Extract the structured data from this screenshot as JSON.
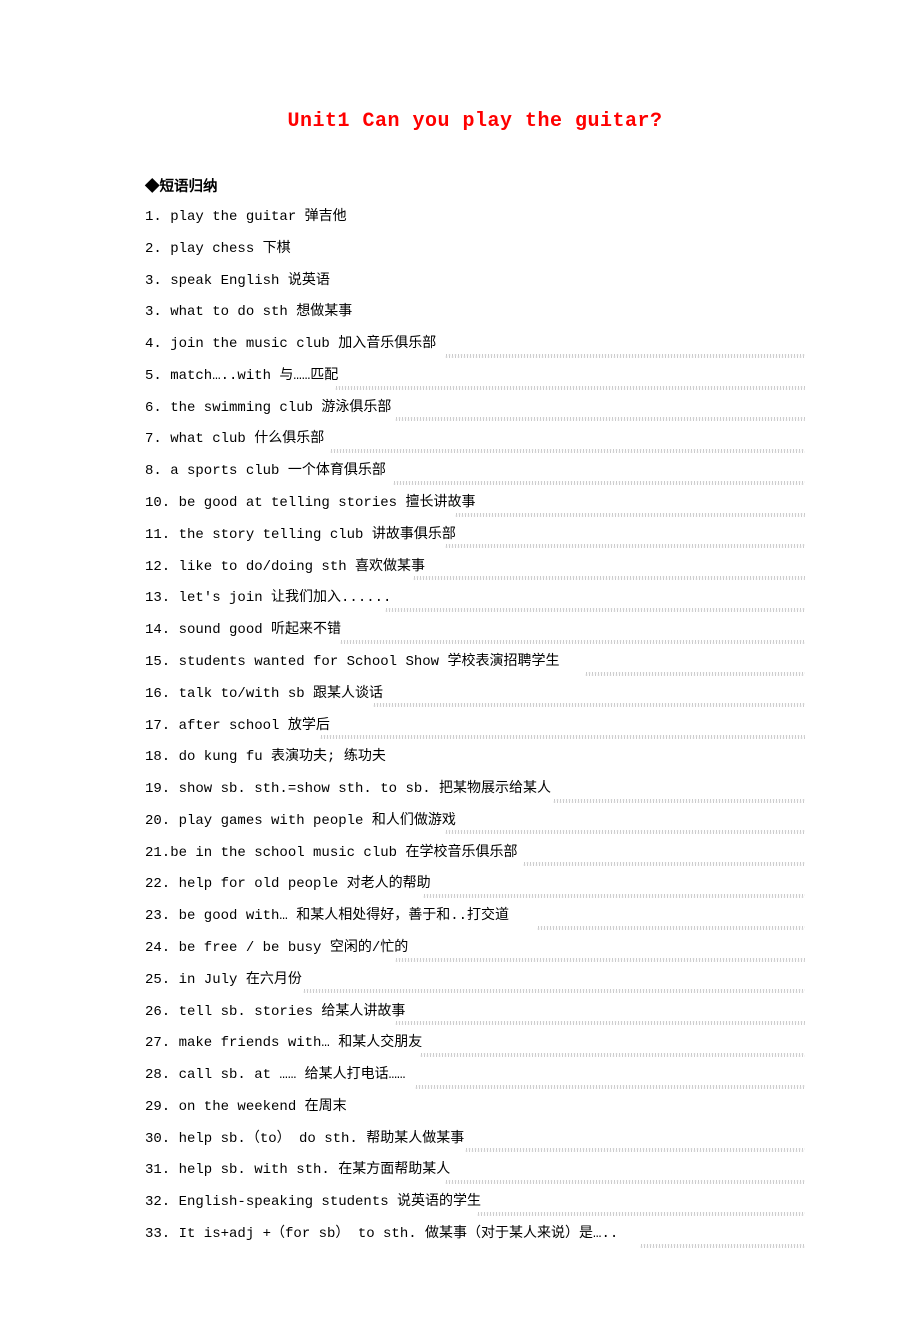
{
  "title": "Unit1 Can you play the guitar?",
  "section_header": "◆短语归纳",
  "items": [
    {
      "num": "1.",
      "text": "play the guitar 弹吉他",
      "waveLeft": null
    },
    {
      "num": "2.",
      "text": "play chess 下棋",
      "waveLeft": null
    },
    {
      "num": "3.",
      "text": "speak English 说英语",
      "waveLeft": null
    },
    {
      "num": "3.",
      "text": "what to do sth 想做某事",
      "waveLeft": null
    },
    {
      "num": "4.",
      "text": "join the music club 加入音乐俱乐部",
      "waveLeft": 300
    },
    {
      "num": "5.",
      "text": "match…..with 与……匹配",
      "waveLeft": 190
    },
    {
      "num": "6.",
      "text": "the swimming club 游泳俱乐部",
      "waveLeft": 250
    },
    {
      "num": "7.",
      "text": "what club 什么俱乐部",
      "waveLeft": 185
    },
    {
      "num": "8.",
      "text": "a sports club 一个体育俱乐部",
      "waveLeft": 248
    },
    {
      "num": "10.",
      "text": "be good at telling stories 擅长讲故事",
      "waveLeft": 310
    },
    {
      "num": "11.",
      "text": "the story telling club 讲故事俱乐部",
      "waveLeft": 300
    },
    {
      "num": "12.",
      "text": "like to do/doing sth 喜欢做某事",
      "waveLeft": 268
    },
    {
      "num": "13.",
      "text": "let's join 让我们加入......",
      "waveLeft": 240
    },
    {
      "num": "14.",
      "text": "sound good 听起来不错",
      "waveLeft": 195
    },
    {
      "num": "15.",
      "text": "students wanted for School Show 学校表演招聘学生",
      "waveLeft": 440
    },
    {
      "num": "16.",
      "text": "talk to/with sb 跟某人谈话",
      "waveLeft": 228
    },
    {
      "num": "17.",
      "text": "after school 放学后",
      "waveLeft": 175
    },
    {
      "num": "18.",
      "text": "do kung fu 表演功夫; 练功夫",
      "waveLeft": null
    },
    {
      "num": "19.",
      "text": "show sb. sth.=show sth. to sb. 把某物展示给某人",
      "waveLeft": 408
    },
    {
      "num": "20.",
      "text": "play games with people 和人们做游戏",
      "waveLeft": 300
    },
    {
      "num": "21.",
      "text": "be in the school music club 在学校音乐俱乐部",
      "waveLeft": 378,
      "noSpace": true
    },
    {
      "num": "22.",
      "text": "help for old people 对老人的帮助",
      "waveLeft": 278
    },
    {
      "num": "23.",
      "text": "be good with… 和某人相处得好，善于和..打交道",
      "waveLeft": 392
    },
    {
      "num": "24.",
      "text": "be free / be busy 空闲的/忙的",
      "waveLeft": 250
    },
    {
      "num": "25.",
      "text": "in July 在六月份",
      "waveLeft": 158
    },
    {
      "num": "26.",
      "text": "tell sb. stories 给某人讲故事",
      "waveLeft": 250
    },
    {
      "num": "27.",
      "text": "make friends with… 和某人交朋友",
      "waveLeft": 275
    },
    {
      "num": "28.",
      "text": "call sb. at …… 给某人打电话……",
      "waveLeft": 270
    },
    {
      "num": "29.",
      "text": "on the weekend 在周末",
      "waveLeft": null
    },
    {
      "num": "30.",
      "text": "help sb.（to） do sth. 帮助某人做某事",
      "waveLeft": 320
    },
    {
      "num": "31.",
      "text": "help sb. with sth. 在某方面帮助某人",
      "waveLeft": 300
    },
    {
      "num": "32.",
      "text": "English-speaking students 说英语的学生",
      "waveLeft": 332
    },
    {
      "num": "33.",
      "text": "It is+adj +（for sb） to sth.  做某事（对于某人来说）是…..",
      "waveLeft": 495
    }
  ]
}
